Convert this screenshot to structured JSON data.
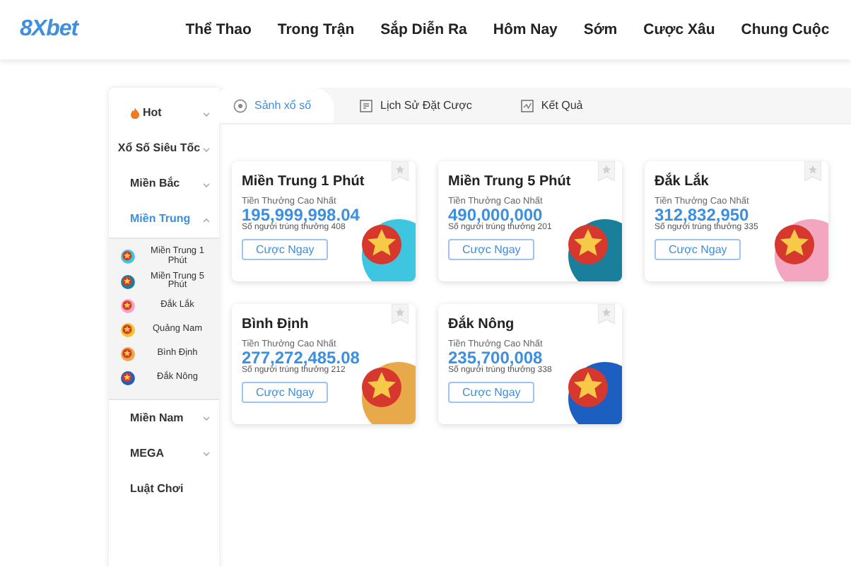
{
  "header": {
    "logo": "8Xbet",
    "nav": [
      "Thể Thao",
      "Trong Trận",
      "Sắp Diễn Ra",
      "Hôm Nay",
      "Sớm",
      "Cược Xâu",
      "Chung Cuộc"
    ]
  },
  "sidebar": {
    "items": [
      {
        "label": "Hot",
        "kind": "hot",
        "selected": false,
        "expanded": false
      },
      {
        "label": "Xổ Số Siêu Tốc",
        "kind": "group",
        "selected": false,
        "expanded": false
      },
      {
        "label": "Miền Bắc",
        "kind": "group",
        "selected": false,
        "expanded": false
      },
      {
        "label": "Miền Trung",
        "kind": "group",
        "selected": true,
        "expanded": true,
        "children": [
          {
            "label": "Miền Trung 1 Phút",
            "color": "#3ec6e0"
          },
          {
            "label": "Miền Trung 5 Phút",
            "color": "#1a7f9a"
          },
          {
            "label": "Đắk Lắk",
            "color": "#f4a6c0"
          },
          {
            "label": "Quảng Nam",
            "color": "#f2c230"
          },
          {
            "label": "Bình Định",
            "color": "#e8a94a"
          },
          {
            "label": "Đắk Nông",
            "color": "#1d5fc0"
          }
        ]
      },
      {
        "label": "Miền Nam",
        "kind": "group",
        "selected": false,
        "expanded": false
      },
      {
        "label": "MEGA",
        "kind": "group",
        "selected": false,
        "expanded": false
      },
      {
        "label": "Luật Chơi",
        "kind": "link",
        "selected": false,
        "expanded": false
      }
    ]
  },
  "tabs": [
    {
      "label": "Sảnh xổ số",
      "kind": "lobby",
      "selected": true
    },
    {
      "label": "Lịch Sử Đặt Cược",
      "kind": "history",
      "selected": false
    },
    {
      "label": "Kết Quả",
      "kind": "results",
      "selected": false
    }
  ],
  "cards": [
    {
      "title": "Miền Trung 1 Phút",
      "prize_label": "Tiền Thưởng Cao Nhất",
      "prize": "195,999,998.04",
      "winners": "Số người trúng thưởng 408",
      "button": "Cược Ngay",
      "color": "#3ec6e0"
    },
    {
      "title": "Miền Trung 5 Phút",
      "prize_label": "Tiền Thưởng Cao Nhất",
      "prize": "490,000,000",
      "winners": "Số người trúng thưởng 201",
      "button": "Cược Ngay",
      "color": "#1a7f9a"
    },
    {
      "title": "Đắk Lắk",
      "prize_label": "Tiền Thưởng Cao Nhất",
      "prize": "312,832,950",
      "winners": "Số người trúng thưởng 335",
      "button": "Cược Ngay",
      "color": "#f4a6c0"
    },
    {
      "title": "Bình Định",
      "prize_label": "Tiền Thưởng Cao Nhất",
      "prize": "277,272,485.08",
      "winners": "Số người trúng thưởng 212",
      "button": "Cược Ngay",
      "color": "#e8a94a"
    },
    {
      "title": "Đắk Nông",
      "prize_label": "Tiền Thưởng Cao Nhất",
      "prize": "235,700,008",
      "winners": "Số người trúng thưởng 338",
      "button": "Cược Ngay",
      "color": "#1d5fc0"
    }
  ]
}
